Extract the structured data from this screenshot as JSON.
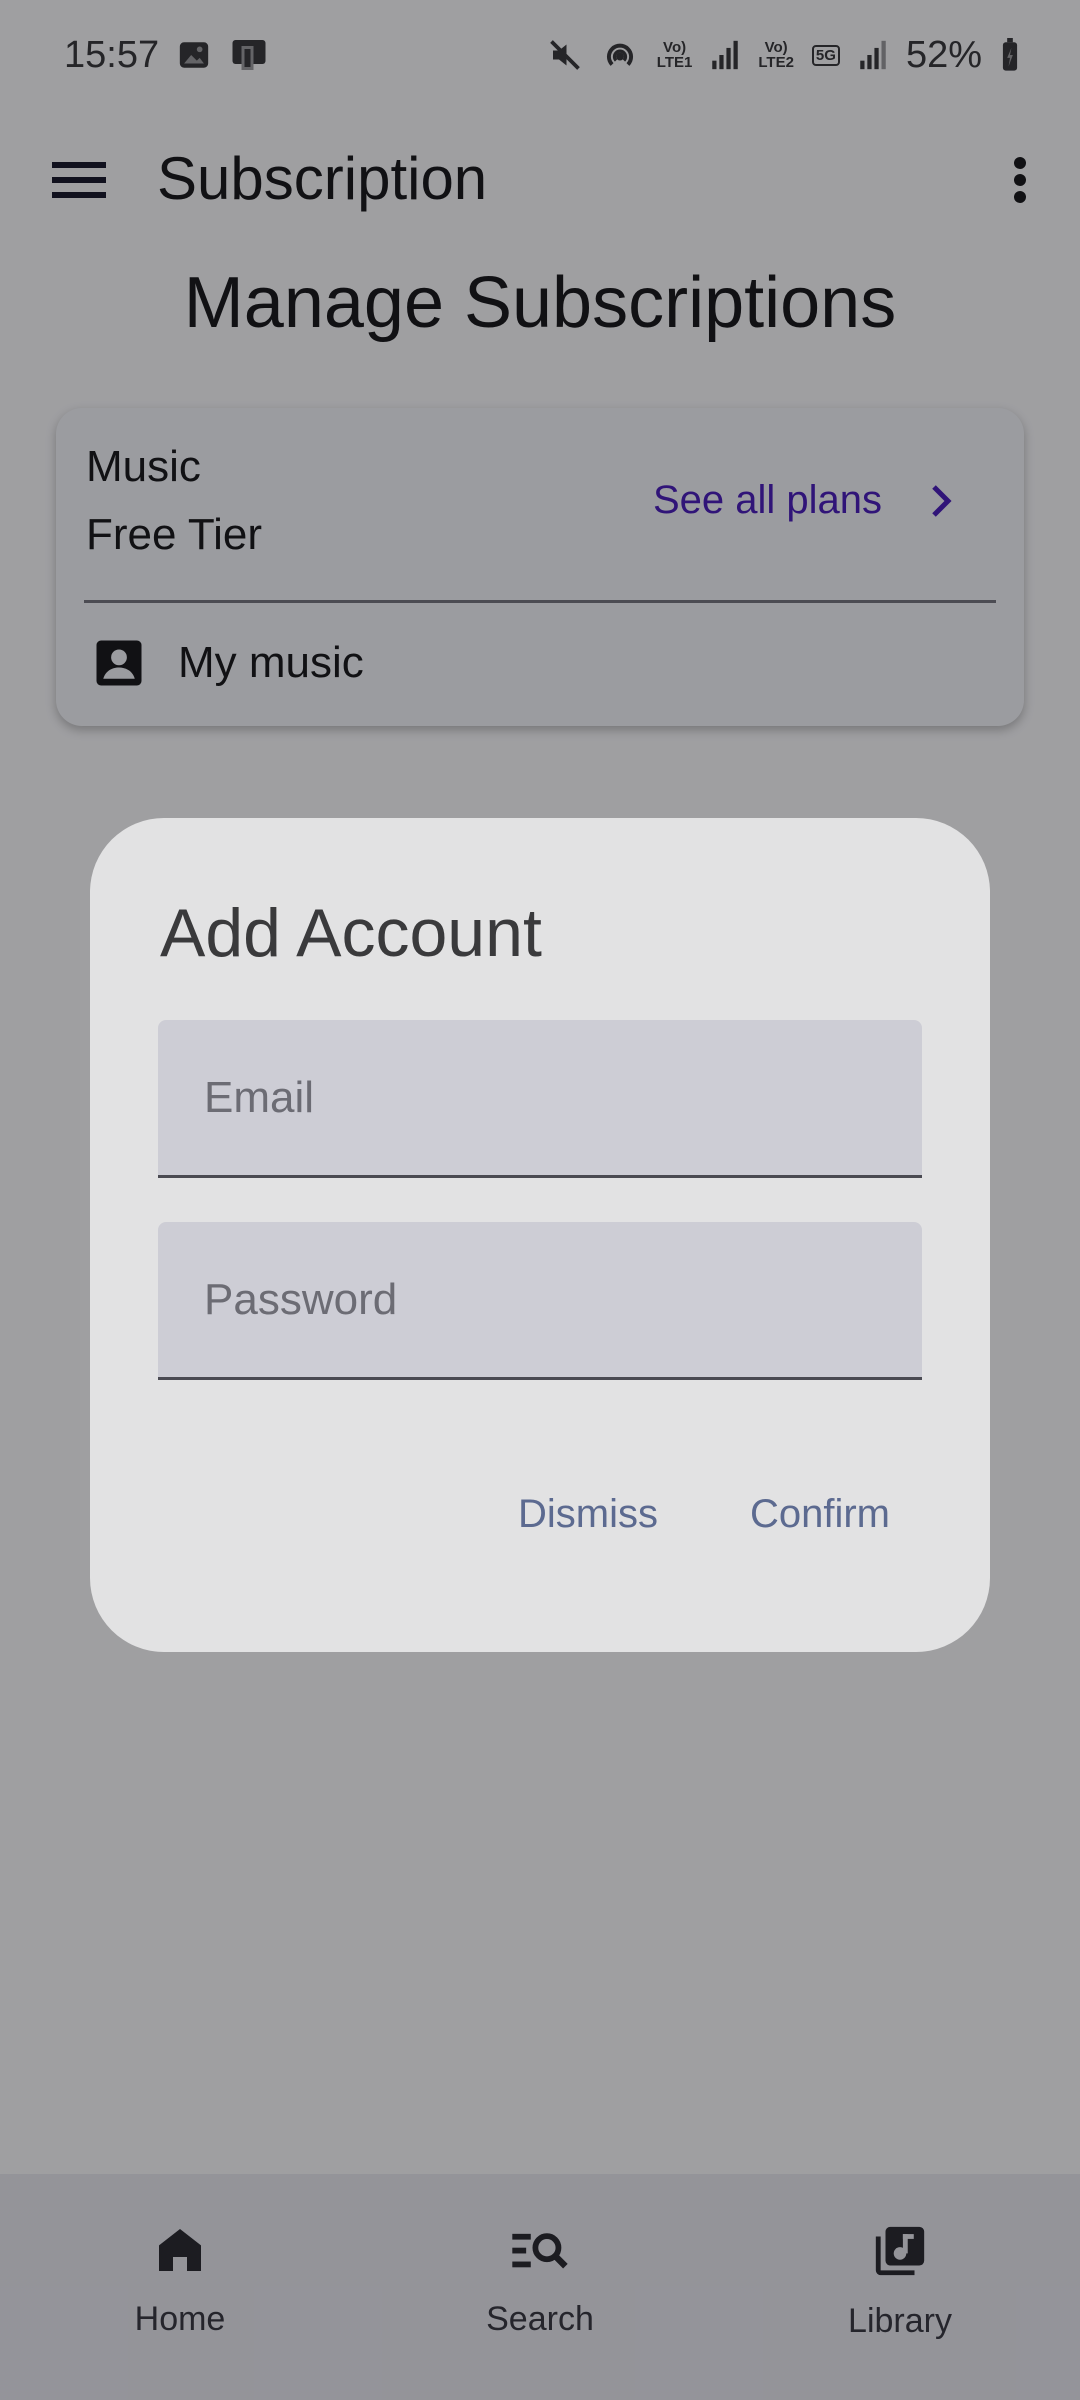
{
  "status_bar": {
    "time": "15:57",
    "lte1": "LTE1",
    "lte2": "LTE2",
    "network": "5G",
    "battery": "52%"
  },
  "app_bar": {
    "title": "Subscription"
  },
  "page": {
    "heading": "Manage Subscriptions"
  },
  "subscription_card": {
    "plan_name": "Music",
    "plan_tier": "Free Tier",
    "see_all_plans": "See all plans",
    "my_music": "My music"
  },
  "dialog": {
    "title": "Add Account",
    "email_placeholder": "Email",
    "password_placeholder": "Password",
    "dismiss": "Dismiss",
    "confirm": "Confirm"
  },
  "bottom_nav": {
    "items": [
      {
        "label": "Home",
        "icon": "home-icon"
      },
      {
        "label": "Search",
        "icon": "search-icon"
      },
      {
        "label": "Library",
        "icon": "library-music-icon"
      }
    ]
  },
  "colors": {
    "accent": "#4a1fb8",
    "dialog_button": "#5c6a90"
  }
}
